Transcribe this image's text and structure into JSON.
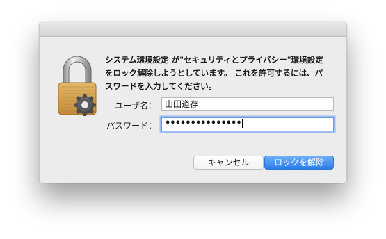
{
  "dialog": {
    "message": "システム環境設定 が\"セキュリティとプライバシー\"環境設定\nをロック解除しようとしています。 これを許可するには、パ\nスワードを入力してください。",
    "username_label": "ユーザ名：",
    "username_value": "山田道存",
    "password_label": "パスワード：",
    "password_masked": "•••••••••••••••",
    "cancel_button": "キャンセル",
    "unlock_button": "ロックを解除",
    "icon": "lock-with-gear-icon"
  },
  "colors": {
    "dialog_bg": "#ececec",
    "primary_button": "#3b8cf0",
    "focus_ring": "#9dbdf0",
    "lock_body": "#d4a258"
  }
}
